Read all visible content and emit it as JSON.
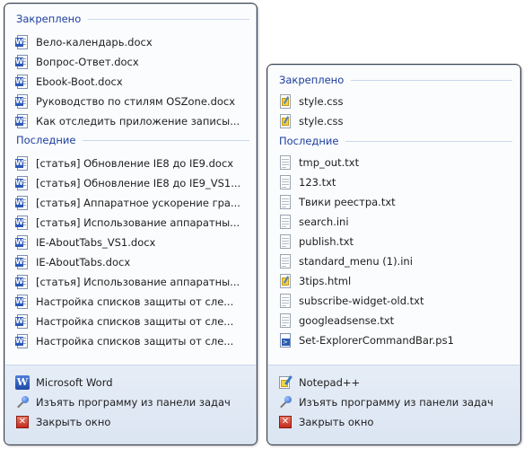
{
  "word_jumplist": {
    "pinned_header": "Закреплено",
    "pinned": [
      {
        "label": "Вело-календарь.docx",
        "icon": "word-document-icon"
      },
      {
        "label": "Вопрос-Ответ.docx",
        "icon": "word-document-icon"
      },
      {
        "label": "Ebook-Boot.docx",
        "icon": "word-document-icon"
      },
      {
        "label": "Руководство по стилям OSZone.docx",
        "icon": "word-document-icon"
      },
      {
        "label": "Как отследить приложение записы...",
        "icon": "word-document-icon"
      }
    ],
    "recent_header": "Последние",
    "recent": [
      {
        "label": "[статья] Обновление IE8 до IE9.docx",
        "icon": "word-document-icon"
      },
      {
        "label": "[статья] Обновление IE8 до IE9_VS1...",
        "icon": "word-document-icon"
      },
      {
        "label": "[статья] Аппаратное ускорение гра...",
        "icon": "word-document-icon"
      },
      {
        "label": "[статья] Использование аппаратны...",
        "icon": "word-document-icon"
      },
      {
        "label": "IE-AboutTabs_VS1.docx",
        "icon": "word-document-icon"
      },
      {
        "label": "IE-AboutTabs.docx",
        "icon": "word-document-icon"
      },
      {
        "label": "[статья] Использование аппаратны...",
        "icon": "word-document-icon"
      },
      {
        "label": "Настройка списков защиты от сле...",
        "icon": "word-document-icon"
      },
      {
        "label": "Настройка списков защиты от сле...",
        "icon": "word-document-icon"
      },
      {
        "label": "Настройка списков защиты от сле...",
        "icon": "word-document-icon"
      }
    ],
    "tasks": [
      {
        "label": "Microsoft Word",
        "icon": "microsoft-word-icon"
      },
      {
        "label": "Изъять программу из панели задач",
        "icon": "pin-icon"
      },
      {
        "label": "Закрыть окно",
        "icon": "close-icon"
      }
    ]
  },
  "notepad_jumplist": {
    "pinned_header": "Закреплено",
    "pinned": [
      {
        "label": "style.css",
        "icon": "css-file-icon"
      },
      {
        "label": "style.css",
        "icon": "css-file-icon"
      }
    ],
    "recent_header": "Последние",
    "recent": [
      {
        "label": "tmp_out.txt",
        "icon": "text-file-icon"
      },
      {
        "label": "123.txt",
        "icon": "text-file-icon"
      },
      {
        "label": "Твики реестра.txt",
        "icon": "text-file-icon"
      },
      {
        "label": "search.ini",
        "icon": "text-file-icon"
      },
      {
        "label": "publish.txt",
        "icon": "text-file-icon"
      },
      {
        "label": "standard_menu (1).ini",
        "icon": "text-file-icon"
      },
      {
        "label": "3tips.html",
        "icon": "html-file-icon"
      },
      {
        "label": "subscribe-widget-old.txt",
        "icon": "text-file-icon"
      },
      {
        "label": "googleadsense.txt",
        "icon": "text-file-icon"
      },
      {
        "label": "Set-ExplorerCommandBar.ps1",
        "icon": "powershell-file-icon"
      }
    ],
    "tasks": [
      {
        "label": "Notepad++",
        "icon": "notepad-plus-plus-icon"
      },
      {
        "label": "Изъять программу из панели задач",
        "icon": "pin-icon"
      },
      {
        "label": "Закрыть окно",
        "icon": "close-icon"
      }
    ]
  },
  "colors": {
    "header_text": "#1b3e9e",
    "border": "#3d4046",
    "task_area": "#dbe5f2"
  }
}
